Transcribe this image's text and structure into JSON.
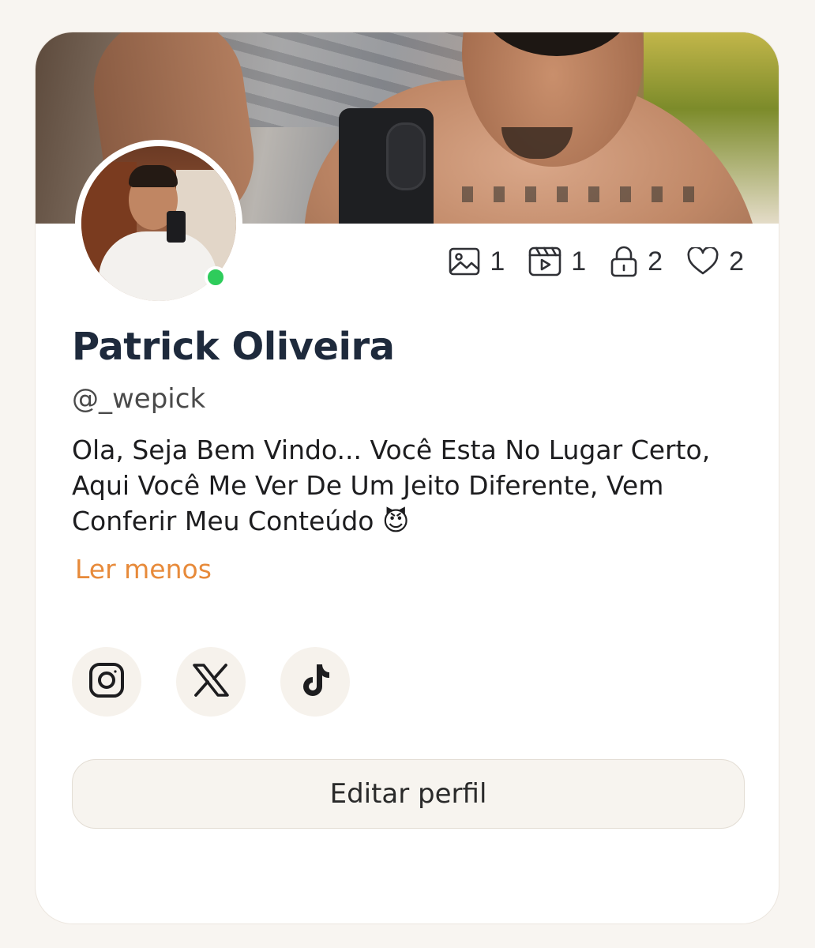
{
  "profile": {
    "name": "Patrick Oliveira",
    "handle": "@_wepick",
    "bio": "Ola, Seja Bem Vindo... Você Esta No Lugar Certo, Aqui Você Me Ver De Um Jeito Diferente, Vem Conferir Meu Conteúdo 😈",
    "read_less_label": "Ler menos",
    "online": true
  },
  "stats": [
    {
      "icon": "image-icon",
      "value": "1"
    },
    {
      "icon": "video-icon",
      "value": "1"
    },
    {
      "icon": "lock-icon",
      "value": "2"
    },
    {
      "icon": "heart-icon",
      "value": "2"
    }
  ],
  "socials": [
    {
      "icon": "instagram-icon"
    },
    {
      "icon": "x-icon",
      "glyph": "𝕏"
    },
    {
      "icon": "tiktok-icon",
      "glyph": "♪"
    }
  ],
  "actions": {
    "edit_profile_label": "Editar perfil"
  },
  "colors": {
    "accent": "#e78a3a",
    "online": "#2ecc5b",
    "name": "#1e2a3c",
    "page_bg": "#f8f5f1"
  }
}
